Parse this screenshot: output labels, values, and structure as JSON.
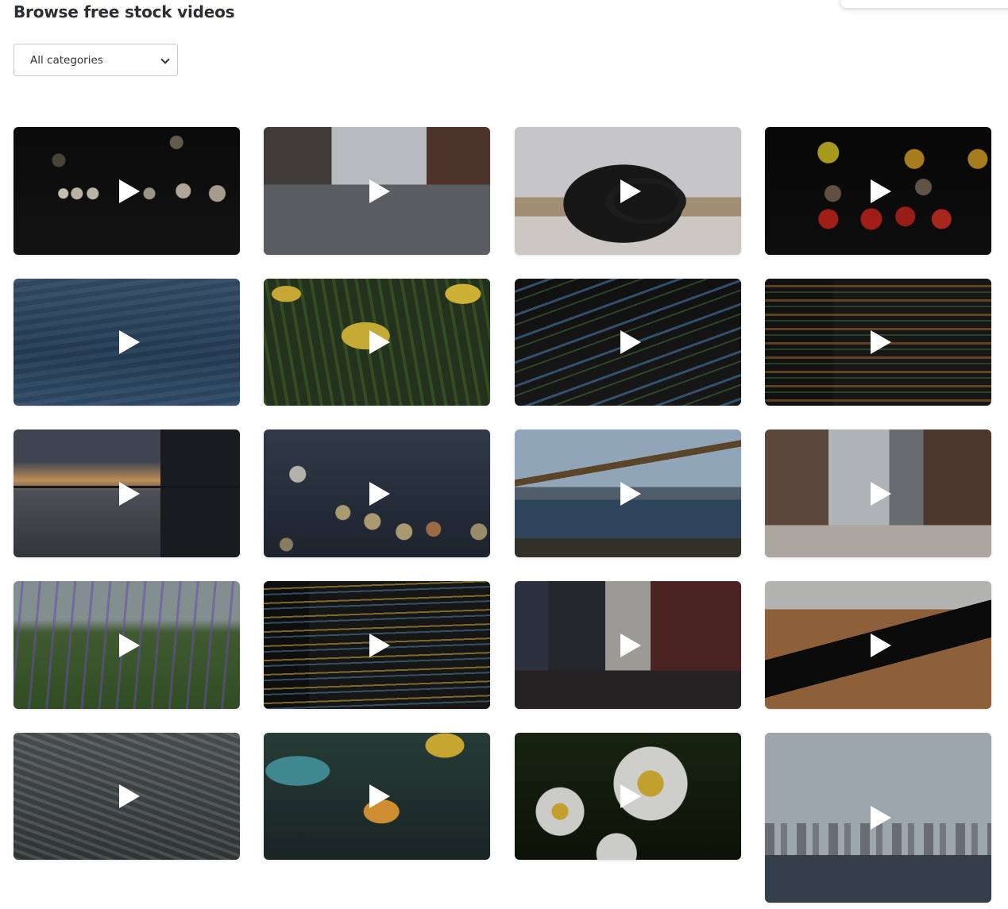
{
  "page": {
    "title": "Browse free stock videos"
  },
  "filter": {
    "selected": "All categories"
  },
  "videos": [
    {
      "thumbnail": "night-street-bokeh-lights"
    },
    {
      "thumbnail": "city-street-intersection"
    },
    {
      "thumbnail": "camera-on-desk"
    },
    {
      "thumbnail": "colorful-bokeh-lights"
    },
    {
      "thumbnail": "blue-water-ripples"
    },
    {
      "thumbnail": "yellow-daffodils"
    },
    {
      "thumbnail": "code-on-screen-blue"
    },
    {
      "thumbnail": "code-on-screen-orange"
    },
    {
      "thumbnail": "sunset-skyline-over-water"
    },
    {
      "thumbnail": "city-lights-bokeh-dusk"
    },
    {
      "thumbnail": "brooklyn-bridge-river"
    },
    {
      "thumbnail": "city-avenue-aerial"
    },
    {
      "thumbnail": "purple-wildflowers-field"
    },
    {
      "thumbnail": "code-editor-close-up"
    },
    {
      "thumbnail": "times-square-crowd"
    },
    {
      "thumbnail": "smartphone-on-wooden-desk"
    },
    {
      "thumbnail": "ocean-waves-foam"
    },
    {
      "thumbnail": "clownfish-aquarium"
    },
    {
      "thumbnail": "white-daisies"
    },
    {
      "thumbnail": "city-skyline-sailboat"
    }
  ],
  "icons": {
    "play": "play-icon",
    "dropdown": "chevron-down-icon"
  },
  "colors": {
    "title": "#2b2f33",
    "play_icon": "#ffffff"
  }
}
